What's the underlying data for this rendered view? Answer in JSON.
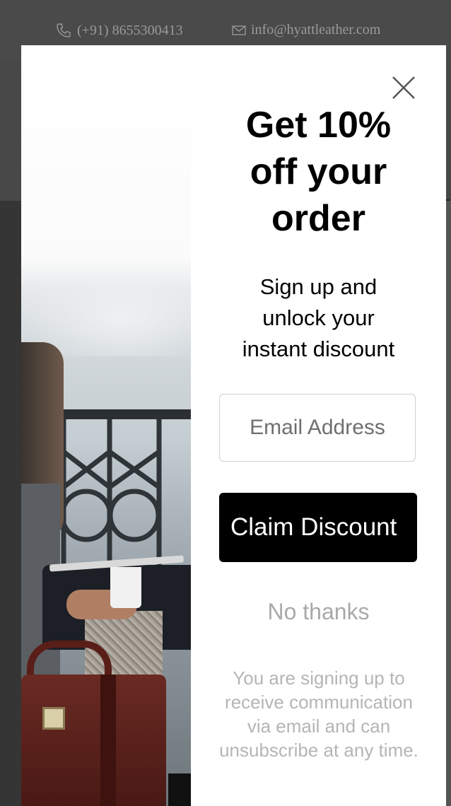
{
  "background_page": {
    "phone": "(+91) 8655300413",
    "email": "info@hyattleather.com"
  },
  "popup": {
    "headline_lines": [
      "Get 10%",
      "off your",
      "order"
    ],
    "subhead_lines": [
      "Sign up and",
      "unlock your",
      "instant discount"
    ],
    "email_placeholder": "Email Address",
    "claim_label": "Claim Discount",
    "no_thanks": "No thanks",
    "disclaimer": "You are signing up to receive communication via email and can unsubscribe at any time."
  },
  "icons": {
    "phone": "phone-icon",
    "email": "envelope-icon",
    "close": "close-icon"
  },
  "colors": {
    "overlay": "#3f3f3f",
    "popup_bg": "#ffffff",
    "button_bg": "#000000",
    "button_text": "#ffffff",
    "muted_text": "#a9a9a9"
  }
}
